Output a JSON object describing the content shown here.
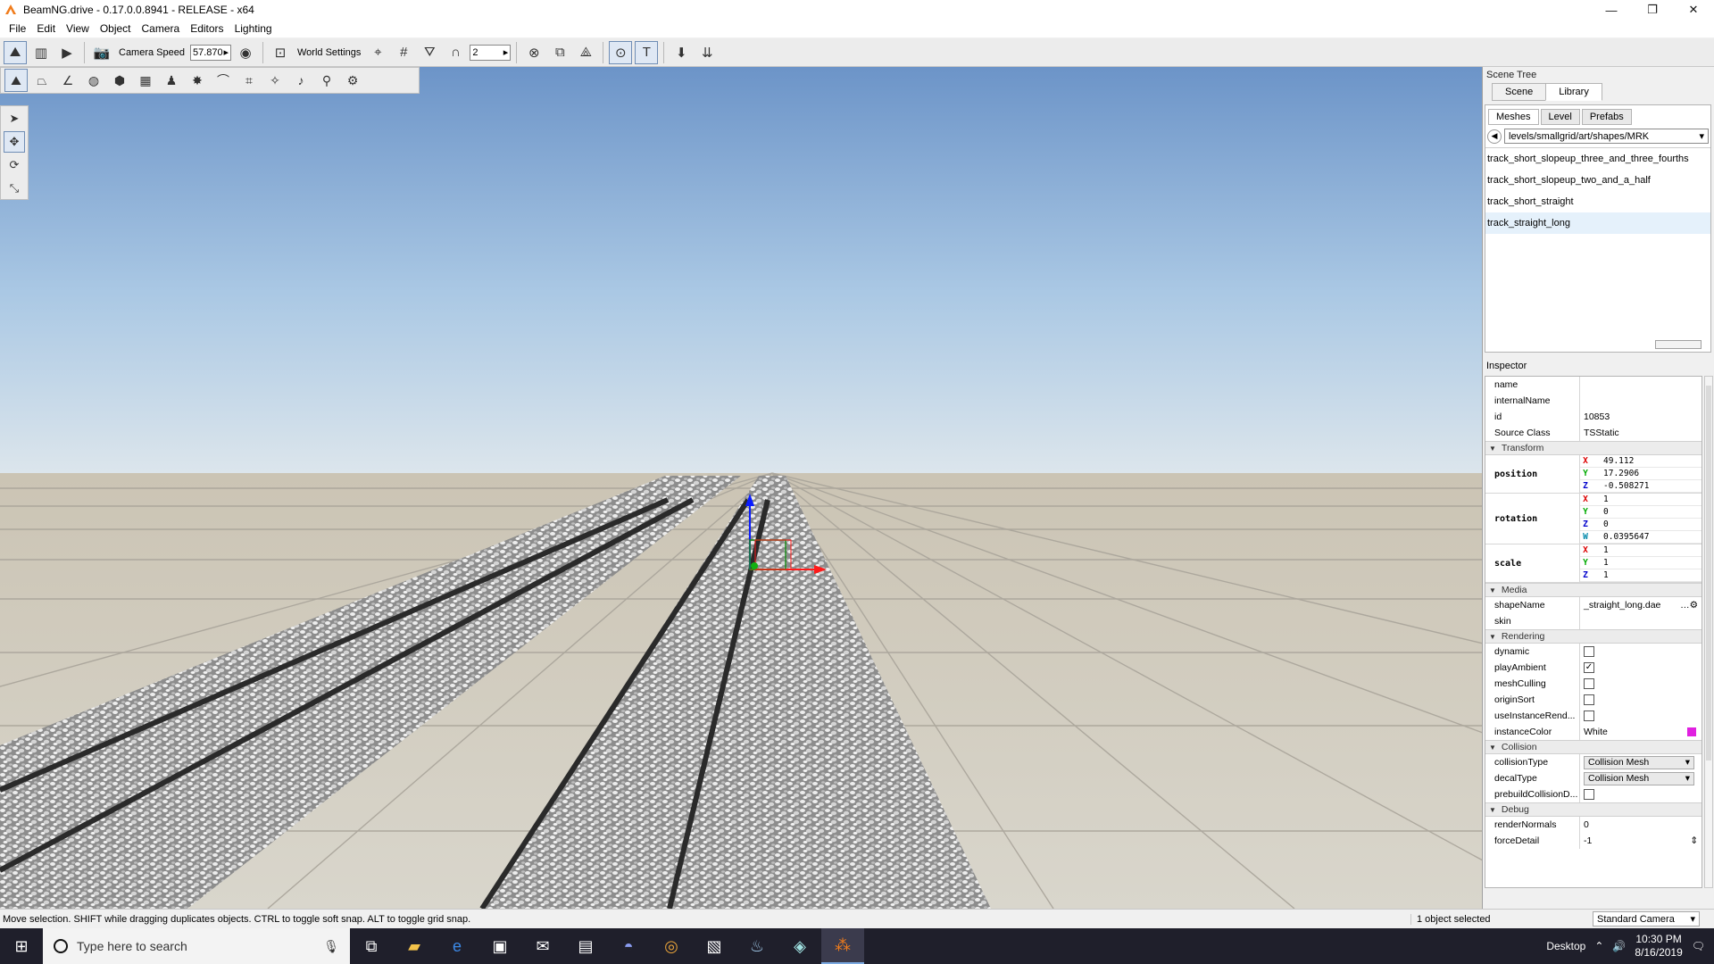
{
  "window": {
    "title": "BeamNG.drive - 0.17.0.0.8941 - RELEASE - x64",
    "minimize": "—",
    "maximize": "❐",
    "close": "✕"
  },
  "menu": [
    "File",
    "Edit",
    "View",
    "Object",
    "Camera",
    "Editors",
    "Lighting"
  ],
  "toolbar": {
    "camera_speed_label": "Camera Speed",
    "camera_speed_value": "57.870",
    "world_settings_label": "World Settings",
    "grid_value": "2"
  },
  "scene_tree": {
    "title": "Scene Tree",
    "tabs": [
      "Scene",
      "Library"
    ],
    "active_tab": "Library",
    "subtabs": [
      "Meshes",
      "Level",
      "Prefabs"
    ],
    "path": "levels/smallgrid/art/shapes/MRK",
    "items": [
      "track_short_slopeup_three_and_three_fourths",
      "track_short_slopeup_two_and_a_half",
      "track_short_straight",
      "track_straight_long"
    ],
    "selected_index": 3
  },
  "inspector": {
    "title": "Inspector",
    "basic": [
      {
        "k": "name",
        "v": ""
      },
      {
        "k": "internalName",
        "v": ""
      },
      {
        "k": "id",
        "v": "10853"
      },
      {
        "k": "Source Class",
        "v": "TSStatic"
      }
    ],
    "transform_label": "Transform",
    "position": {
      "label": "position",
      "x": "49.112",
      "y": "17.2906",
      "z": "-0.508271"
    },
    "rotation": {
      "label": "rotation",
      "x": "1",
      "y": "0",
      "z": "0",
      "w": "0.0395647"
    },
    "scale": {
      "label": "scale",
      "x": "1",
      "y": "1",
      "z": "1"
    },
    "media_label": "Media",
    "shape_name_label": "shapeName",
    "shape_name_value": "_straight_long.dae",
    "skin_label": "skin",
    "rendering_label": "Rendering",
    "rendering": [
      {
        "k": "dynamic",
        "checked": false
      },
      {
        "k": "playAmbient",
        "checked": true
      },
      {
        "k": "meshCulling",
        "checked": false
      },
      {
        "k": "originSort",
        "checked": false
      },
      {
        "k": "useInstanceRend...",
        "checked": false
      }
    ],
    "instance_color_label": "instanceColor",
    "instance_color_value": "White",
    "instance_color_swatch": "#e020e0",
    "collision_label": "Collision",
    "collision_type_label": "collisionType",
    "collision_type_value": "Collision Mesh",
    "decal_type_label": "decalType",
    "decal_type_value": "Collision Mesh",
    "prebuild_label": "prebuildCollisionD...",
    "debug_label": "Debug",
    "render_normals_label": "renderNormals",
    "render_normals_value": "0",
    "force_detail_label": "forceDetail",
    "force_detail_value": "-1"
  },
  "status": {
    "message": "Move selection.  SHIFT while dragging duplicates objects.  CTRL to toggle soft snap.  ALT to toggle grid snap.",
    "selection": "1 object selected",
    "camera": "Standard Camera"
  },
  "taskbar": {
    "search_placeholder": "Type here to search",
    "desktop_label": "Desktop",
    "time": "10:30 PM",
    "date": "8/16/2019"
  }
}
